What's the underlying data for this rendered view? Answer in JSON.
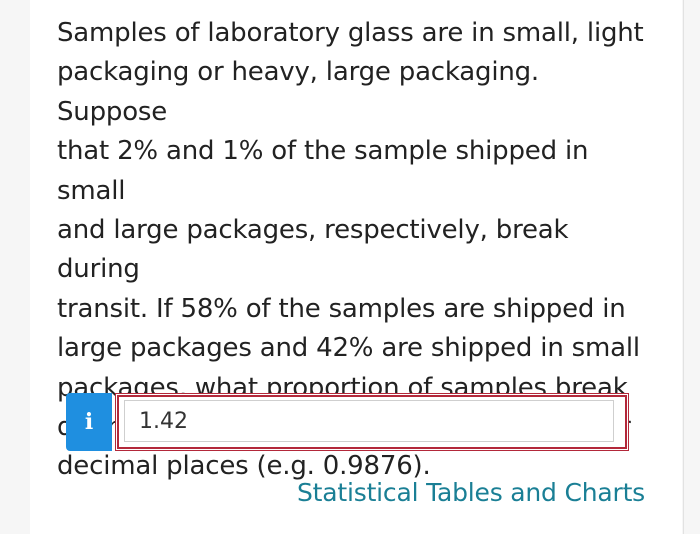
{
  "question": {
    "text": "Samples of laboratory glass are in small, light\npackaging or heavy, large packaging. Suppose\nthat 2% and 1% of the sample shipped in small\nand large packages, respectively, break during\ntransit. If 58% of the samples are shipped in\nlarge packages and 42% are shipped in small\npackages, what proportion of samples break\nduring shipment? Round your answer to four\ndecimal places (e.g. 0.9876)."
  },
  "answer": {
    "info_icon": "i",
    "value": "1.42"
  },
  "links": {
    "tables_label": "Statistical Tables and Charts"
  },
  "colors": {
    "info_button": "#1f8fe0",
    "answer_border_error": "#b3283a",
    "link": "#1a7f95"
  },
  "icons": {
    "info": "info-icon"
  }
}
